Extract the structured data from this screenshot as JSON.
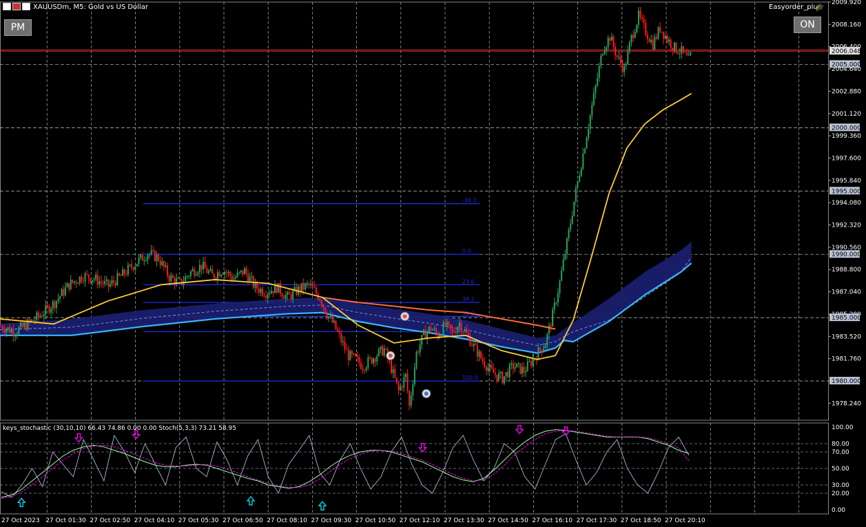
{
  "header": {
    "symbol_title": "XAUUSDm, M5:  Gold vs US Dollar",
    "ea_name": "Easyorder_plus"
  },
  "buttons": {
    "pm": "PM",
    "on": "ON"
  },
  "icons": {
    "chart_menu": "chart-type-icons",
    "ea": "graduation-cap-icon"
  },
  "colors": {
    "bull": "#26a65b",
    "bear": "#ff1a1a",
    "grid": "#c8c8c8",
    "ma_fast": "#ffcc33",
    "ma_slow": "#ff6a3d",
    "band_fill": "#1a1f6e",
    "band_lower": "#37b7ff",
    "fib": "#1d2bd6",
    "bid_line": "#ff3333",
    "stoch_main": "#a9b6cf",
    "stoch_signal": "#ff00ff",
    "stoch_slow": "#9cff9c",
    "arrow_up": "#00e5ff",
    "arrow_down": "#ff00ff"
  },
  "chart_data": [
    {
      "type": "candlestick",
      "timeframe": "M5",
      "ylim": [
        1976.9,
        2009.92
      ],
      "y_ticks": [
        "2009.920",
        "2008.160",
        "2006.400",
        "2004.640",
        "2002.880",
        "2001.120",
        "1999.360",
        "1997.600",
        "1995.840",
        "1994.080",
        "1992.320",
        "1990.560",
        "1988.800",
        "1987.040",
        "1985.280",
        "1983.520",
        "1981.760",
        "1980.000",
        "1978.240"
      ],
      "y_tick_values": [
        2009.92,
        2008.16,
        2006.4,
        2004.64,
        2002.88,
        2001.12,
        1999.36,
        1997.6,
        1995.84,
        1994.08,
        1992.32,
        1990.56,
        1988.8,
        1987.04,
        1985.28,
        1983.52,
        1981.76,
        1980.0,
        1978.24
      ],
      "price_tags": [
        {
          "label": "2006.048",
          "value": 2006.048,
          "kind": "bid"
        },
        {
          "label": "2005.000",
          "value": 2005.0,
          "kind": "level"
        },
        {
          "label": "2000.000",
          "value": 2000.0,
          "kind": "level"
        },
        {
          "label": "1995.000",
          "value": 1995.0,
          "kind": "level"
        },
        {
          "label": "1990.000",
          "value": 1990.0,
          "kind": "level"
        },
        {
          "label": "1985.000",
          "value": 1985.0,
          "kind": "level"
        },
        {
          "label": "1980.000",
          "value": 1980.0,
          "kind": "level"
        }
      ],
      "x_labels": [
        "27 Oct 2023",
        "27 Oct 01:30",
        "27 Oct 02:50",
        "27 Oct 04:10",
        "27 Oct 05:30",
        "27 Oct 06:50",
        "27 Oct 08:10",
        "27 Oct 09:30",
        "27 Oct 10:50",
        "27 Oct 12:10",
        "27 Oct 13:30",
        "27 Oct 14:50",
        "27 Oct 16:10",
        "27 Oct 17:30",
        "27 Oct 18:50",
        "27 Oct 20:10"
      ],
      "close_path": [
        [
          0,
          1984.3
        ],
        [
          8,
          1983.9
        ],
        [
          16,
          1984.6
        ],
        [
          22,
          1985.2
        ],
        [
          30,
          1986.2
        ],
        [
          38,
          1987.6
        ],
        [
          46,
          1988.3
        ],
        [
          52,
          1988.1
        ],
        [
          60,
          1987.5
        ],
        [
          68,
          1988.4
        ],
        [
          76,
          1989.4
        ],
        [
          82,
          1990.1
        ],
        [
          88,
          1989.7
        ],
        [
          94,
          1988.2
        ],
        [
          100,
          1987.7
        ],
        [
          106,
          1988.6
        ],
        [
          112,
          1989.1
        ],
        [
          118,
          1988.3
        ],
        [
          124,
          1988.8
        ],
        [
          130,
          1988.1
        ],
        [
          136,
          1988.7
        ],
        [
          142,
          1987.4
        ],
        [
          148,
          1987.0
        ],
        [
          154,
          1987.4
        ],
        [
          160,
          1986.6
        ],
        [
          166,
          1987.2
        ],
        [
          172,
          1987.6
        ],
        [
          178,
          1986.6
        ],
        [
          182,
          1985.3
        ],
        [
          186,
          1984.4
        ],
        [
          190,
          1983.2
        ],
        [
          194,
          1982.0
        ],
        [
          198,
          1981.7
        ],
        [
          202,
          1981.2
        ],
        [
          206,
          1981.6
        ],
        [
          210,
          1982.1
        ],
        [
          214,
          1982.5
        ],
        [
          218,
          1981.0
        ],
        [
          222,
          1979.2
        ],
        [
          226,
          1980.4
        ],
        [
          228,
          1978.0
        ],
        [
          232,
          1982.2
        ],
        [
          236,
          1983.6
        ],
        [
          240,
          1984.2
        ],
        [
          244,
          1983.6
        ],
        [
          248,
          1984.4
        ],
        [
          252,
          1983.8
        ],
        [
          256,
          1984.6
        ],
        [
          262,
          1983.2
        ],
        [
          268,
          1981.8
        ],
        [
          274,
          1980.7
        ],
        [
          280,
          1980.2
        ],
        [
          286,
          1981.2
        ],
        [
          292,
          1980.8
        ],
        [
          298,
          1981.9
        ],
        [
          304,
          1983.0
        ],
        [
          308,
          1985.2
        ],
        [
          312,
          1987.8
        ],
        [
          316,
          1990.9
        ],
        [
          320,
          1994.2
        ],
        [
          324,
          1997.2
        ],
        [
          328,
          2000.2
        ],
        [
          332,
          2003.2
        ],
        [
          336,
          2006.2
        ],
        [
          340,
          2007.2
        ],
        [
          344,
          2005.6
        ],
        [
          348,
          2004.6
        ],
        [
          352,
          2007.1
        ],
        [
          356,
          2008.8
        ],
        [
          360,
          2007.6
        ],
        [
          364,
          2006.6
        ],
        [
          368,
          2007.9
        ],
        [
          372,
          2007.0
        ],
        [
          376,
          2006.3
        ],
        [
          380,
          2006.0
        ],
        [
          384,
          2005.3
        ],
        [
          386,
          2006.0
        ]
      ],
      "ma_fast": [
        [
          0,
          1984.9
        ],
        [
          30,
          1984.5
        ],
        [
          60,
          1986.3
        ],
        [
          90,
          1987.6
        ],
        [
          120,
          1988.0
        ],
        [
          150,
          1987.7
        ],
        [
          180,
          1986.6
        ],
        [
          200,
          1984.4
        ],
        [
          220,
          1983.0
        ],
        [
          240,
          1983.4
        ],
        [
          260,
          1983.6
        ],
        [
          280,
          1982.4
        ],
        [
          300,
          1981.7
        ],
        [
          310,
          1982.0
        ],
        [
          320,
          1984.8
        ],
        [
          330,
          1989.7
        ],
        [
          340,
          1994.8
        ],
        [
          350,
          1998.4
        ],
        [
          360,
          2000.3
        ],
        [
          370,
          2001.4
        ],
        [
          380,
          2002.2
        ],
        [
          386,
          2002.7
        ]
      ],
      "ma_slow": [
        [
          180,
          1986.6
        ],
        [
          200,
          1986.2
        ],
        [
          220,
          1985.9
        ],
        [
          240,
          1985.6
        ],
        [
          260,
          1985.4
        ],
        [
          280,
          1984.9
        ],
        [
          300,
          1984.4
        ],
        [
          310,
          1984.1
        ]
      ],
      "band_upper": [
        [
          0,
          1984.5
        ],
        [
          40,
          1984.9
        ],
        [
          80,
          1985.6
        ],
        [
          120,
          1986.1
        ],
        [
          160,
          1986.5
        ],
        [
          180,
          1986.6
        ],
        [
          200,
          1986.1
        ],
        [
          220,
          1985.7
        ],
        [
          240,
          1985.3
        ],
        [
          260,
          1984.8
        ],
        [
          280,
          1984.1
        ],
        [
          300,
          1983.4
        ],
        [
          310,
          1983.6
        ],
        [
          320,
          1984.6
        ],
        [
          340,
          1986.5
        ],
        [
          360,
          1988.6
        ],
        [
          380,
          1990.3
        ],
        [
          386,
          1991.0
        ]
      ],
      "band_lower": [
        [
          0,
          1983.6
        ],
        [
          40,
          1983.6
        ],
        [
          80,
          1984.3
        ],
        [
          120,
          1984.9
        ],
        [
          160,
          1985.3
        ],
        [
          180,
          1985.4
        ],
        [
          200,
          1984.7
        ],
        [
          220,
          1984.2
        ],
        [
          240,
          1983.8
        ],
        [
          260,
          1983.3
        ],
        [
          280,
          1982.7
        ],
        [
          300,
          1982.2
        ],
        [
          310,
          1982.6
        ],
        [
          315,
          1983.2
        ],
        [
          320,
          1983.1
        ],
        [
          340,
          1984.7
        ],
        [
          360,
          1986.8
        ],
        [
          380,
          1988.6
        ],
        [
          386,
          1989.3
        ]
      ],
      "fib_levels": [
        {
          "label": "-38.2",
          "price": 1994.0
        },
        {
          "label": "0.0",
          "price": 1990.0
        },
        {
          "label": "23.6",
          "price": 1987.6
        },
        {
          "label": "38.2",
          "price": 1986.2
        },
        {
          "label": "50.0",
          "price": 1985.1
        },
        {
          "label": "61.8",
          "price": 1983.9
        },
        {
          "label": "100.0",
          "price": 1980.0
        }
      ],
      "markers": [
        {
          "kind": "sell",
          "bar": 226,
          "price": 1985.1
        },
        {
          "kind": "sell",
          "bar": 218,
          "price": 1982.0
        },
        {
          "kind": "buy",
          "bar": 238,
          "price": 1979.0
        }
      ]
    },
    {
      "type": "line",
      "title": "keys_stochastic (30,10,10) 66.43 74.86 0.00 0.00 Stoch(5,3,3) 73.21 58.95",
      "ylim": [
        0,
        100
      ],
      "y_ticks": [
        "100.00",
        "80.00",
        "70.00",
        "50.00",
        "30.00",
        "20.00",
        "0.00"
      ],
      "y_tick_values": [
        100,
        80,
        70,
        50,
        30,
        20,
        0
      ],
      "series": [
        {
          "key": "fast",
          "values": [
            22,
            15,
            30,
            50,
            28,
            70,
            55,
            40,
            85,
            60,
            35,
            90,
            70,
            45,
            80,
            55,
            30,
            75,
            88,
            50,
            40,
            82,
            60,
            30,
            65,
            85,
            40,
            20,
            55,
            72,
            90,
            45,
            30,
            60,
            80,
            50,
            25,
            40,
            70,
            88,
            55,
            30,
            20,
            45,
            75,
            90,
            60,
            35,
            50,
            80,
            70,
            40,
            25,
            55,
            85,
            92,
            60,
            30,
            45,
            70,
            85,
            50,
            30,
            20,
            45,
            75,
            88,
            66
          ]
        },
        {
          "key": "slow",
          "values": [
            15,
            18,
            25,
            35,
            45,
            55,
            65,
            72,
            76,
            78,
            76,
            72,
            68,
            63,
            58,
            54,
            52,
            52,
            54,
            55,
            54,
            50,
            46,
            42,
            38,
            35,
            30,
            28,
            26,
            28,
            34,
            42,
            52,
            60,
            66,
            70,
            72,
            72,
            70,
            66,
            62,
            58,
            52,
            46,
            40,
            36,
            34,
            38,
            48,
            60,
            72,
            82,
            90,
            95,
            97,
            96,
            94,
            92,
            90,
            88,
            88,
            88,
            88,
            86,
            82,
            78,
            72,
            68
          ]
        },
        {
          "key": "signal",
          "values": [
            14,
            16,
            22,
            30,
            40,
            50,
            60,
            68,
            74,
            77,
            78,
            76,
            72,
            67,
            62,
            57,
            54,
            53,
            53,
            54,
            55,
            53,
            49,
            45,
            40,
            36,
            32,
            29,
            27,
            27,
            30,
            37,
            46,
            55,
            62,
            67,
            71,
            72,
            71,
            68,
            64,
            60,
            55,
            49,
            43,
            38,
            35,
            36,
            43,
            54,
            66,
            76,
            85,
            92,
            95,
            96,
            95,
            93,
            91,
            89,
            88,
            88,
            88,
            87,
            84,
            80,
            75,
            59
          ]
        }
      ],
      "arrows_up": [
        [
          12,
          8
        ],
        [
          140,
          10
        ],
        [
          180,
          4
        ]
      ],
      "arrows_down": [
        [
          44,
          88
        ],
        [
          76,
          92
        ],
        [
          236,
          76
        ],
        [
          290,
          98
        ],
        [
          316,
          96
        ]
      ]
    }
  ]
}
